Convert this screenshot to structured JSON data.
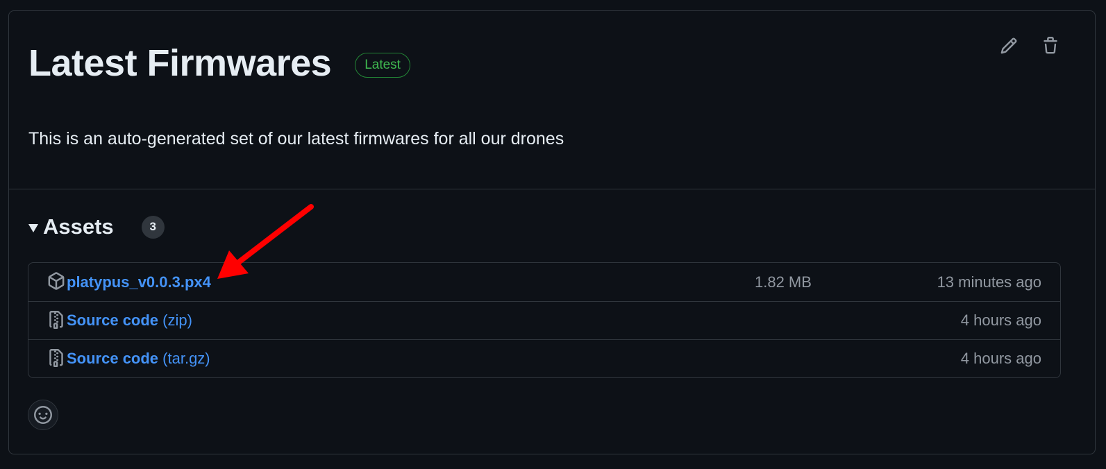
{
  "release": {
    "title": "Latest Firmwares",
    "badge": "Latest",
    "description": "This is an auto-generated set of our latest firmwares for all our drones"
  },
  "actions": {
    "edit_icon": "pencil-icon",
    "delete_icon": "trash-icon"
  },
  "assets": {
    "label": "Assets",
    "count": "3",
    "items": [
      {
        "name": "platypus_v0.0.3.px4",
        "suffix": "",
        "size": "1.82 MB",
        "time": "13 minutes ago",
        "icon": "package-icon"
      },
      {
        "name": "Source code",
        "suffix": "(zip)",
        "size": "",
        "time": "4 hours ago",
        "icon": "file-zip-icon"
      },
      {
        "name": "Source code",
        "suffix": "(tar.gz)",
        "size": "",
        "time": "4 hours ago",
        "icon": "file-zip-icon"
      }
    ]
  },
  "reactions": {
    "icon": "smiley-icon"
  },
  "annotation": {
    "color": "#ff0000"
  },
  "colors": {
    "background": "#0d1117",
    "border": "#30363d",
    "link": "#4493f8",
    "badge_green": "#3fb950",
    "muted": "#9198a1"
  }
}
